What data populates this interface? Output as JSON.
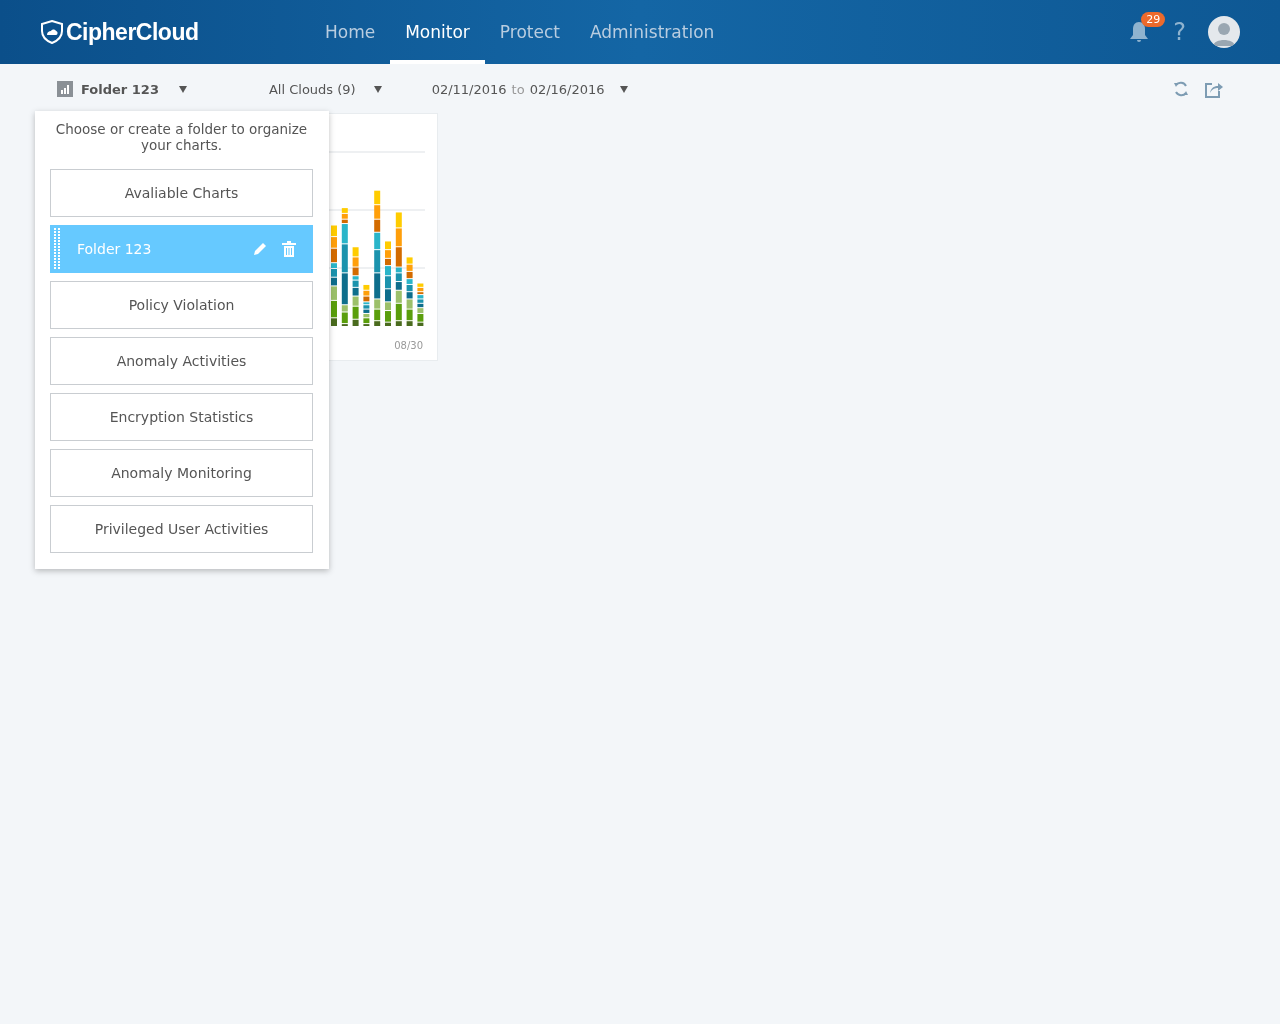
{
  "header": {
    "logo": "CipherCloud",
    "nav": [
      {
        "label": "Home",
        "selected": false
      },
      {
        "label": "Monitor",
        "selected": true
      },
      {
        "label": "Protect",
        "selected": false
      },
      {
        "label": "Administration",
        "selected": false
      }
    ],
    "notification_count": "29",
    "help": "?"
  },
  "toolbar": {
    "folder": "Folder 123",
    "clouds": "All Clouds (9)",
    "date_from": "02/11/2016",
    "date_to_word": "to",
    "date_to": "02/16/2016"
  },
  "chart_card": {
    "x_label": "08/30"
  },
  "folder_menu": {
    "hint": "Choose or create a folder to organize your charts.",
    "items": [
      {
        "label": "Avaliable Charts",
        "selected": false
      },
      {
        "label": "Folder 123",
        "selected": true
      },
      {
        "label": "Policy Violation",
        "selected": false
      },
      {
        "label": "Anomaly Activities",
        "selected": false
      },
      {
        "label": "Encryption Statistics",
        "selected": false
      },
      {
        "label": "Anomaly Monitoring",
        "selected": false
      },
      {
        "label": "Privileged User Activities",
        "selected": false
      }
    ]
  }
}
